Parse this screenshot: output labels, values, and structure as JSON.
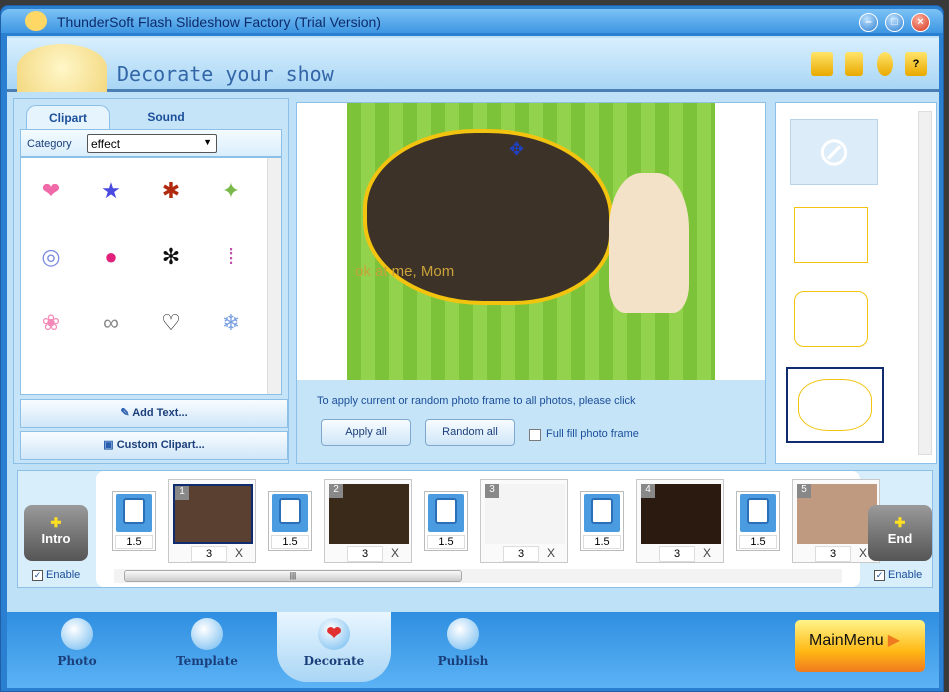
{
  "window": {
    "title": "ThunderSoft Flash Slideshow Factory (Trial Version)",
    "controls": [
      "minimize",
      "maximize",
      "close"
    ]
  },
  "header": {
    "title": "Decorate your show",
    "icons": [
      "open-folder-icon",
      "save-icon",
      "user-icon",
      "help-icon"
    ]
  },
  "left_panel": {
    "tabs": [
      {
        "label": "Clipart",
        "active": true
      },
      {
        "label": "Sound",
        "active": false
      }
    ],
    "category_label": "Category",
    "category_value": "effect",
    "cliparts": [
      "heart",
      "stars",
      "butterfly",
      "confetti",
      "rings",
      "lips",
      "ant",
      "drops",
      "petals",
      "swirl",
      "heart-outline",
      "snowflake"
    ],
    "add_text": "Add Text...",
    "custom_clipart": "Custom Clipart..."
  },
  "preview": {
    "caption": "ok at me, Mom",
    "instruction": "To apply current or random photo frame  to all photos, please click",
    "apply_all": "Apply all",
    "random_all": "Random all",
    "full_fill_label": "Full fill photo frame",
    "full_fill_checked": false
  },
  "frames": {
    "items": [
      "none",
      "rectangle",
      "wavy",
      "cloud"
    ],
    "selected": 3
  },
  "timeline": {
    "intro": {
      "label": "Intro",
      "enable_label": "Enable",
      "enabled": true
    },
    "end": {
      "label": "End",
      "enable_label": "Enable",
      "enabled": true
    },
    "slides": [
      {
        "num": "1",
        "duration": "3"
      },
      {
        "num": "2",
        "duration": "3"
      },
      {
        "num": "3",
        "duration": "3"
      },
      {
        "num": "4",
        "duration": "3"
      },
      {
        "num": "5",
        "duration": "3"
      }
    ],
    "transitions": [
      "1.5",
      "1.5",
      "1.5",
      "1.5",
      "1.5"
    ],
    "delete_label": "X",
    "selected_slide": 1
  },
  "nav": {
    "items": [
      {
        "label": "Photo"
      },
      {
        "label": "Template"
      },
      {
        "label": "Decorate",
        "active": true
      },
      {
        "label": "Publish"
      }
    ],
    "main_menu": "MainMenu"
  }
}
